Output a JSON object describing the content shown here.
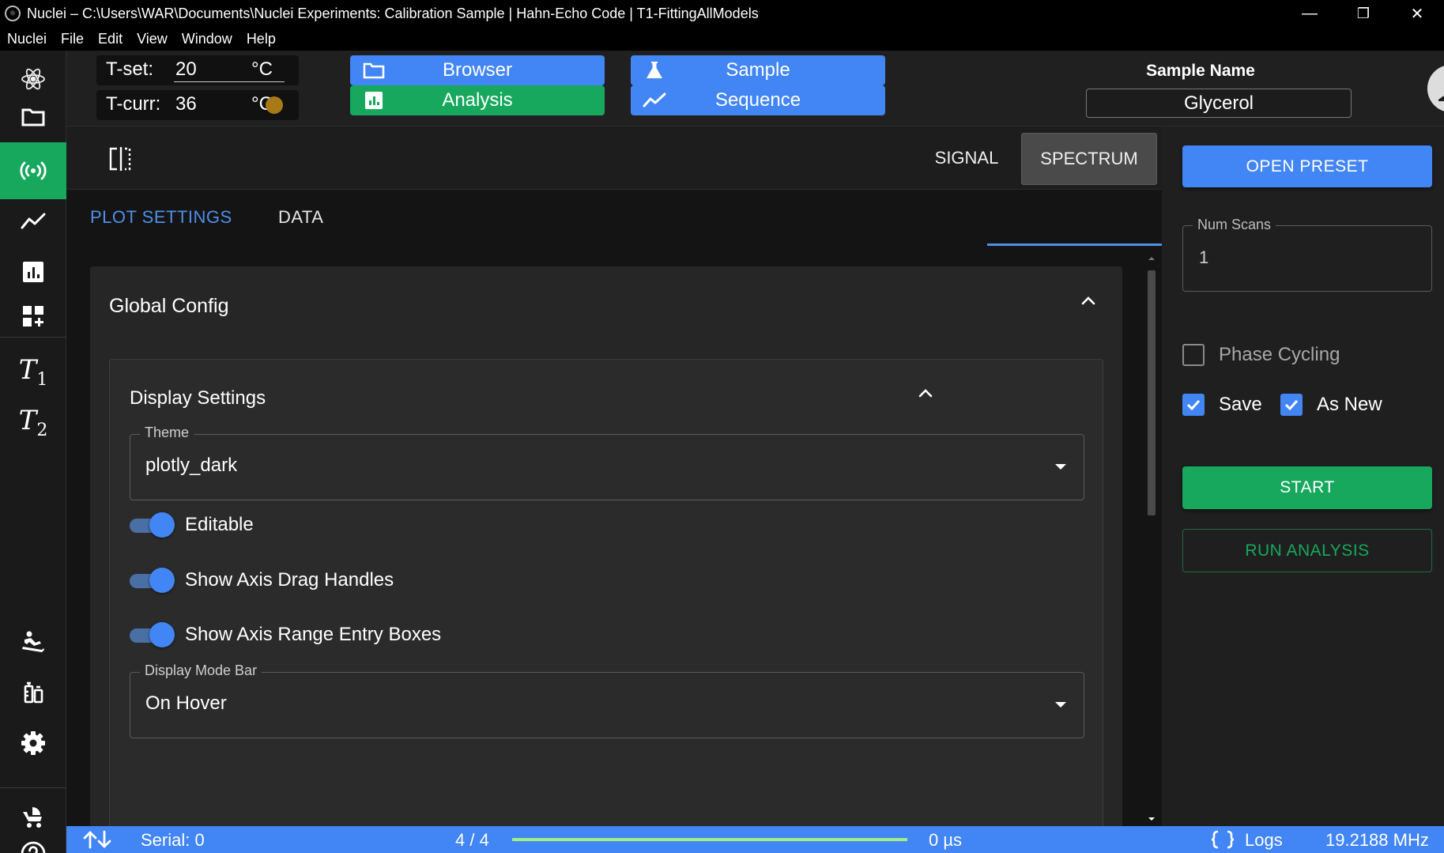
{
  "window": {
    "title": "Nuclei – C:\\Users\\WAR\\Documents\\Nuclei Experiments: Calibration Sample | Hahn-Echo Code | T1-FittingAllModels",
    "minimize": "—",
    "restore": "❐",
    "close": "✕"
  },
  "menu": [
    "Nuclei",
    "File",
    "Edit",
    "View",
    "Window",
    "Help"
  ],
  "sidebar": {
    "items": [
      {
        "icon": "atom-logo-icon"
      },
      {
        "icon": "folder-icon"
      },
      {
        "icon": "signal-broadcast-icon",
        "active": true
      },
      {
        "icon": "line-chart-icon"
      },
      {
        "icon": "bar-chart-icon"
      },
      {
        "icon": "dashboard-add-icon"
      },
      {
        "icon": "t1-icon",
        "label": "T",
        "sub": "1"
      },
      {
        "icon": "t2-icon",
        "label": "T",
        "sub": "2"
      },
      {
        "icon": "sledding-icon"
      },
      {
        "icon": "vaccine-icon"
      },
      {
        "icon": "gear-icon"
      },
      {
        "icon": "stroller-icon"
      },
      {
        "icon": "help-icon"
      }
    ]
  },
  "header": {
    "tset_label": "T-set:",
    "tset_value": "20",
    "tcurr_label": "T-curr:",
    "tcurr_value": "36",
    "unit": "°C",
    "status_color": "#a87a17",
    "buttons": {
      "browser": "Browser",
      "sample": "Sample",
      "analysis": "Analysis",
      "sequence": "Sequence"
    },
    "sample_name_label": "Sample Name",
    "sample_name_value": "Glycerol"
  },
  "plot": {
    "tab_signal": "SIGNAL",
    "tab_spectrum": "SPECTRUM",
    "subtab_plot_settings": "PLOT SETTINGS",
    "subtab_data": "DATA",
    "global_config": "Global Config",
    "display_settings": "Display Settings",
    "theme_label": "Theme",
    "theme_value": "plotly_dark",
    "switches": {
      "editable": "Editable",
      "axis_drag": "Show Axis Drag Handles",
      "axis_range": "Show Axis Range Entry Boxes"
    },
    "mode_bar_label": "Display Mode Bar",
    "mode_bar_value": "On Hover"
  },
  "right": {
    "open_preset": "OPEN PRESET",
    "num_scans_label": "Num Scans",
    "num_scans_value": "1",
    "phase_cycling": "Phase Cycling",
    "save": "Save",
    "as_new": "As New",
    "start": "START",
    "run_analysis": "RUN ANALYSIS"
  },
  "status": {
    "serial": "Serial: 0",
    "progress_text": "4 / 4",
    "progress_fraction": 1.0,
    "time": "0 µs",
    "logs": "Logs",
    "frequency": "19.2188 MHz"
  },
  "colors": {
    "accent_blue": "#4285f4",
    "accent_green": "#17a85e",
    "progress_green": "#9fef86"
  }
}
